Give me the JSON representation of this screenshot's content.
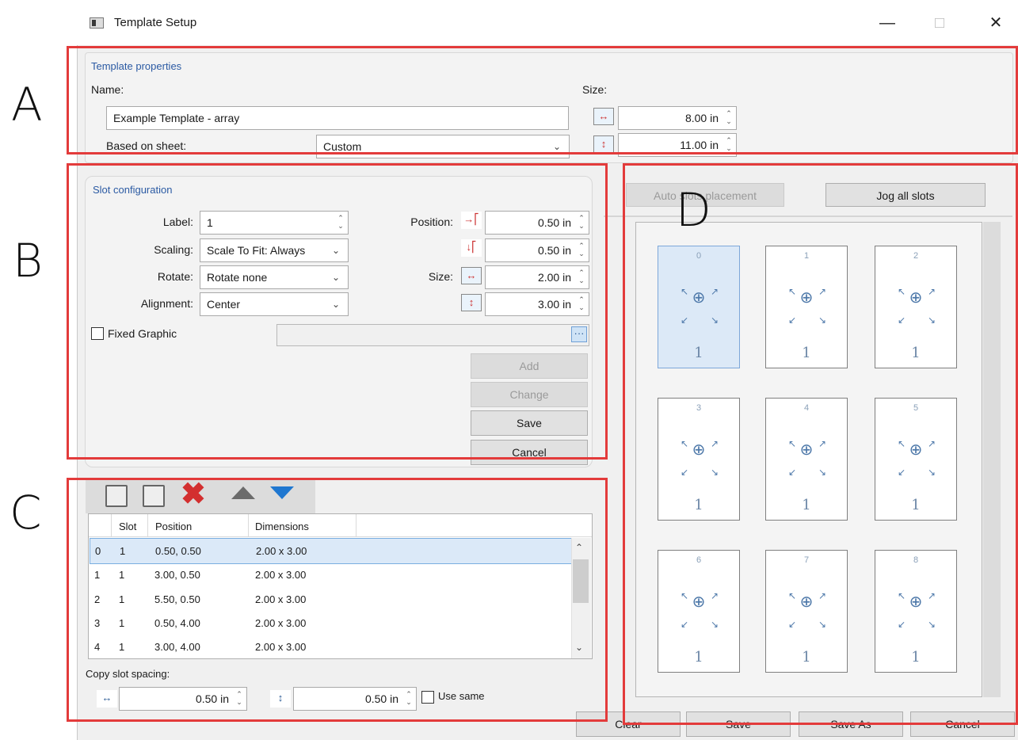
{
  "annotations": {
    "a": "A",
    "b": "B",
    "c": "C",
    "d": "D"
  },
  "window": {
    "title": "Template Setup",
    "minimize": "—",
    "maximize": "□",
    "close": "✕"
  },
  "template_properties": {
    "title": "Template properties",
    "name_label": "Name:",
    "name_value": "Example Template - array",
    "based_on_label": "Based on sheet:",
    "based_on_value": "Custom",
    "size_label": "Size:",
    "width_value": "8.00 in",
    "height_value": "11.00 in"
  },
  "slot_configuration": {
    "title": "Slot configuration",
    "label_label": "Label:",
    "label_value": "1",
    "scaling_label": "Scaling:",
    "scaling_value": "Scale To Fit: Always",
    "rotate_label": "Rotate:",
    "rotate_value": "Rotate none",
    "alignment_label": "Alignment:",
    "alignment_value": "Center",
    "position_label": "Position:",
    "pos_x_value": "0.50 in",
    "pos_y_value": "0.50 in",
    "size_label": "Size:",
    "size_w_value": "2.00 in",
    "size_h_value": "3.00 in",
    "fixed_graphic_label": "Fixed Graphic",
    "browse_label": "···",
    "add_label": "Add",
    "change_label": "Change",
    "save_label": "Save",
    "cancel_label": "Cancel"
  },
  "slot_list": {
    "columns": [
      "Slot",
      "Position",
      "Dimensions"
    ],
    "rows": [
      {
        "index": "0",
        "slot": "1",
        "position": "0.50, 0.50",
        "dimensions": "2.00 x 3.00"
      },
      {
        "index": "1",
        "slot": "1",
        "position": "3.00, 0.50",
        "dimensions": "2.00 x 3.00"
      },
      {
        "index": "2",
        "slot": "1",
        "position": "5.50, 0.50",
        "dimensions": "2.00 x 3.00"
      },
      {
        "index": "3",
        "slot": "1",
        "position": "0.50, 4.00",
        "dimensions": "2.00 x 3.00"
      },
      {
        "index": "4",
        "slot": "1",
        "position": "3.00, 4.00",
        "dimensions": "2.00 x 3.00"
      }
    ],
    "copy_spacing_label": "Copy slot spacing:",
    "spacing_h_value": "0.50 in",
    "spacing_v_value": "0.50 in",
    "use_same_label": "Use same"
  },
  "layout_panel": {
    "auto_placement_label": "Auto slots placement",
    "jog_label": "Jog all slots",
    "slots": [
      {
        "index": "0",
        "label": "1"
      },
      {
        "index": "1",
        "label": "1"
      },
      {
        "index": "2",
        "label": "1"
      },
      {
        "index": "3",
        "label": "1"
      },
      {
        "index": "4",
        "label": "1"
      },
      {
        "index": "5",
        "label": "1"
      },
      {
        "index": "6",
        "label": "1"
      },
      {
        "index": "7",
        "label": "1"
      },
      {
        "index": "8",
        "label": "1"
      }
    ]
  },
  "footer": {
    "clear_label": "Clear",
    "save_label": "Save",
    "save_as_label": "Save As",
    "cancel_label": "Cancel"
  }
}
